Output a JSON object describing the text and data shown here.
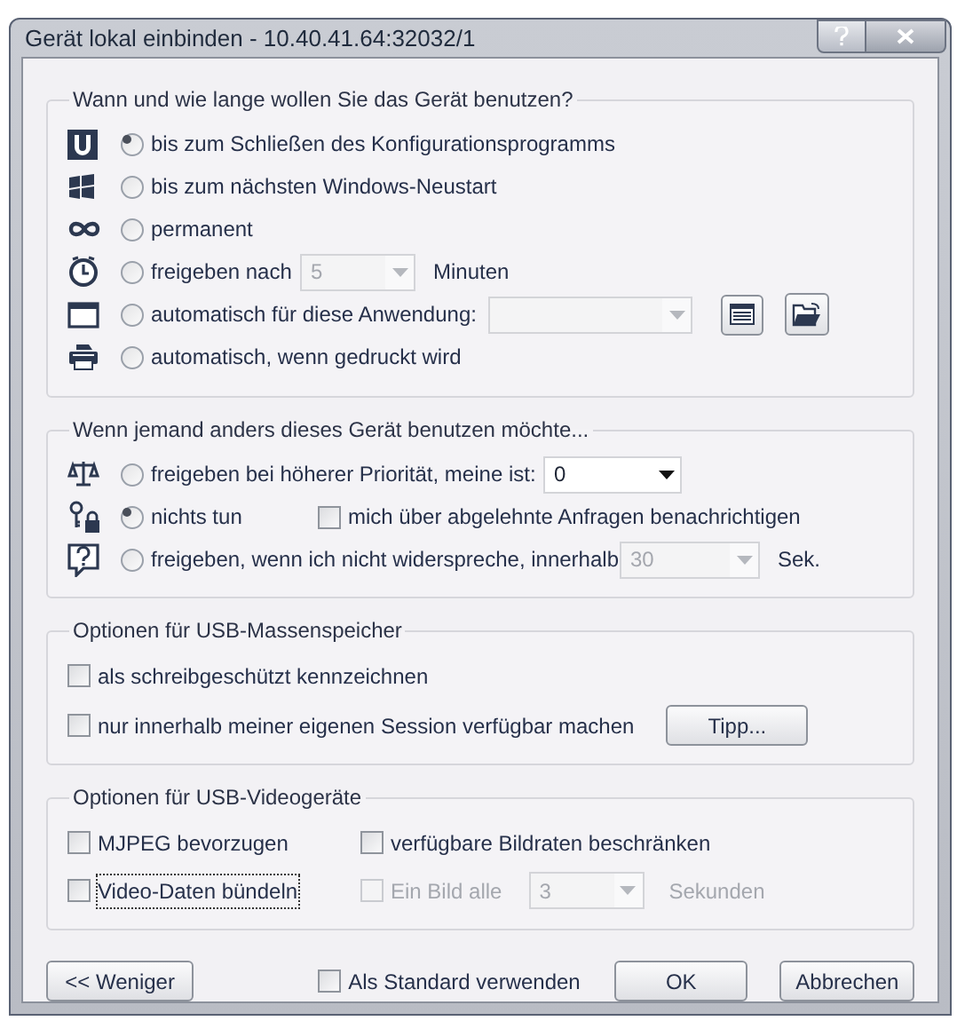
{
  "window": {
    "title": "Gerät lokal einbinden - 10.40.41.64:32032/1"
  },
  "groups": [
    {
      "title": "Wann und wie lange wollen Sie das Gerät benutzen?",
      "rows": [
        {
          "label": "bis zum Schließen des Konfigurationsprogramms",
          "selected": true
        },
        {
          "label": "bis zum nächsten Windows-Neustart",
          "selected": false
        },
        {
          "label": "permanent",
          "selected": false
        },
        {
          "label": "freigeben nach",
          "selected": false,
          "combo": {
            "value": "5",
            "disabled": true
          },
          "suffix": "Minuten"
        },
        {
          "label": "automatisch für diese Anwendung:",
          "selected": false,
          "combo": {
            "disabled": true
          },
          "tools": true
        },
        {
          "label": "automatisch, wenn gedruckt wird",
          "selected": false
        }
      ]
    },
    {
      "title": "Wenn jemand anders dieses Gerät benutzen möchte...",
      "rows": [
        {
          "label": "freigeben bei höherer Priorität, meine ist:",
          "selected": false,
          "combo": {
            "value": "0",
            "disabled": false
          }
        },
        {
          "label": "nichts tun",
          "selected": true,
          "checkbox": {
            "label": "mich über abgelehnte Anfragen benachrichtigen",
            "checked": false
          }
        },
        {
          "label": "freigeben, wenn ich nicht widerspreche, innerhalb",
          "selected": false,
          "combo": {
            "value": "30",
            "disabled": true
          },
          "suffix": "Sek."
        }
      ]
    },
    {
      "title": "Optionen für USB-Massenspeicher",
      "checks": [
        {
          "label": "als schreibgeschützt kennzeichnen",
          "checked": false
        },
        {
          "label": "nur innerhalb meiner eigenen Session verfügbar machen",
          "checked": false,
          "button": "Tipp..."
        }
      ]
    },
    {
      "title": "Optionen für USB-Videogeräte",
      "checks": [
        {
          "label": "MJPEG bevorzugen",
          "checked": false,
          "focused": false
        },
        {
          "label": "verfügbare Bildraten beschränken",
          "checked": false,
          "disabled": false
        },
        {
          "label": "Video-Daten bündeln",
          "checked": false,
          "focused": true
        },
        {
          "label": "Ein Bild alle",
          "checked": false,
          "disabled": true,
          "combo": {
            "value": "3",
            "disabled": true
          },
          "suffix": "Sekunden"
        }
      ]
    }
  ],
  "footer": {
    "less_button": "<< Weniger",
    "default_checkbox": {
      "label": "Als Standard verwenden",
      "checked": false
    },
    "ok_button": "OK",
    "cancel_button": "Abbrechen"
  }
}
